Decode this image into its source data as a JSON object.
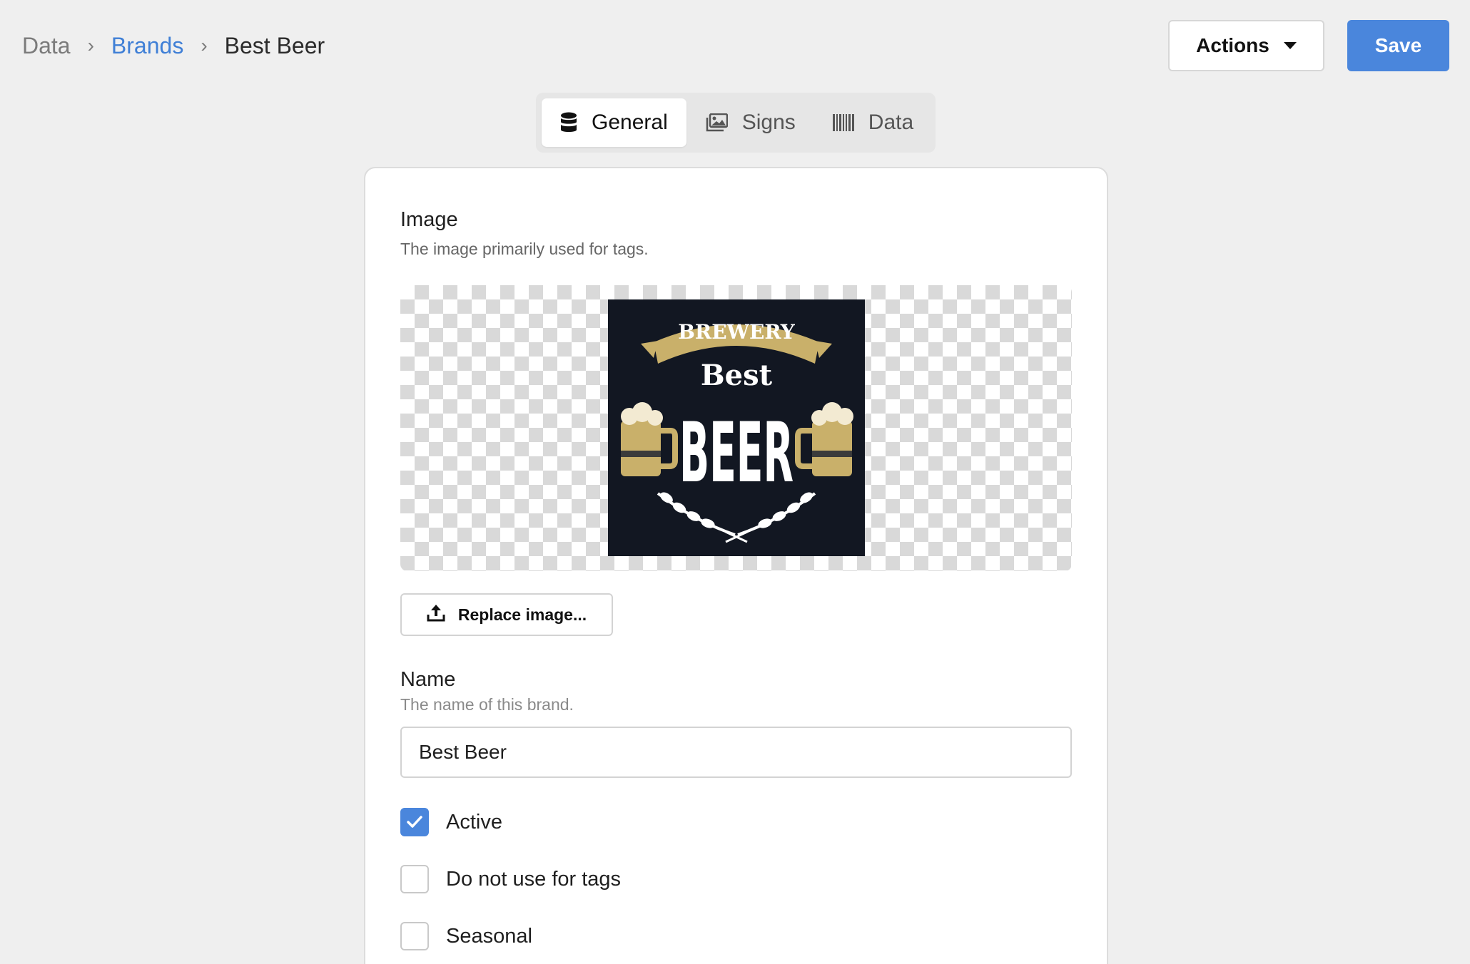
{
  "breadcrumb": {
    "root": "Data",
    "separator": "›",
    "parent": "Brands",
    "current": "Best Beer"
  },
  "header": {
    "actions_label": "Actions",
    "save_label": "Save"
  },
  "tabs": [
    {
      "label": "General",
      "icon": "database-icon",
      "active": true
    },
    {
      "label": "Signs",
      "icon": "images-icon",
      "active": false
    },
    {
      "label": "Data",
      "icon": "barcode-icon",
      "active": false
    }
  ],
  "image_section": {
    "label": "Image",
    "help": "The image primarily used for tags.",
    "logo": {
      "banner_text": "BREWERY",
      "small_text": "Best",
      "big_text": "BEER"
    },
    "replace_label": "Replace image..."
  },
  "name_section": {
    "label": "Name",
    "help": "The name of this brand.",
    "value": "Best Beer"
  },
  "checkboxes": [
    {
      "label": "Active",
      "checked": true
    },
    {
      "label": "Do not use for tags",
      "checked": false
    },
    {
      "label": "Seasonal",
      "checked": false
    }
  ],
  "colors": {
    "accent": "#4a86dc",
    "link": "#3f7fd6",
    "logo_background": "#121722",
    "logo_gold": "#c9b06a"
  }
}
